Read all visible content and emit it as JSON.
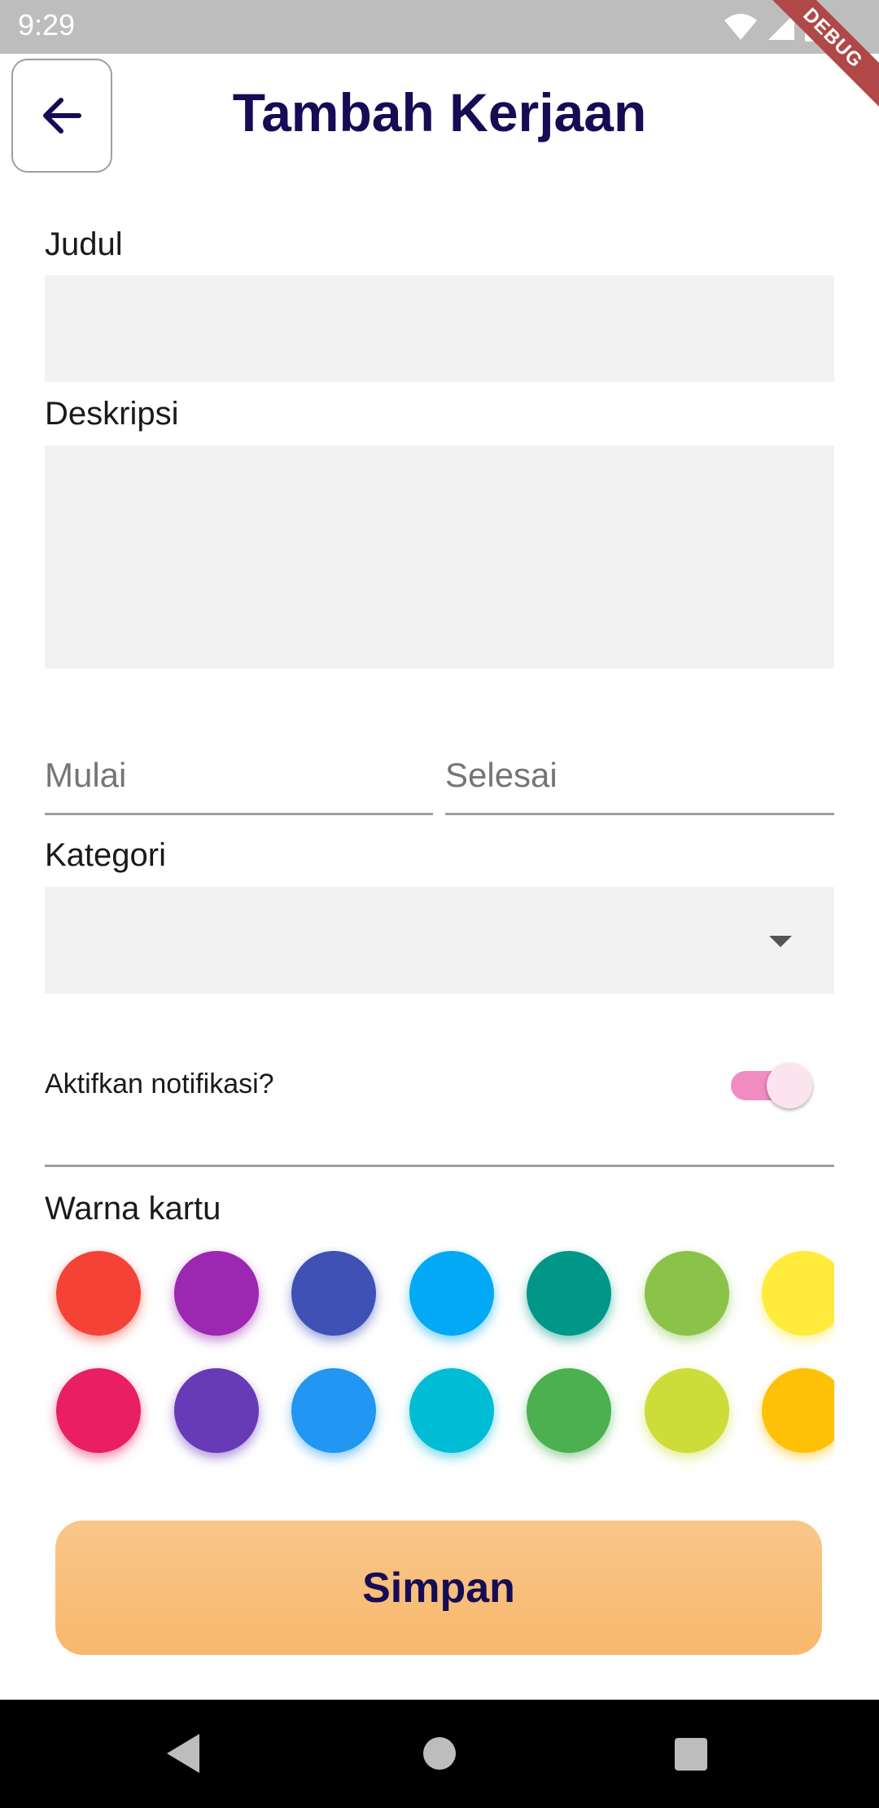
{
  "status_bar": {
    "time": "9:29",
    "debug_label": "DEBUG"
  },
  "header": {
    "title": "Tambah Kerjaan",
    "back_icon": "arrow-left-icon"
  },
  "form": {
    "judul_label": "Judul",
    "judul_value": "",
    "deskripsi_label": "Deskripsi",
    "deskripsi_value": "",
    "mulai_placeholder": "Mulai",
    "selesai_placeholder": "Selesai",
    "kategori_label": "Kategori",
    "kategori_value": "",
    "notification_label": "Aktifkan notifikasi?",
    "notification_enabled": true,
    "card_color_label": "Warna kartu"
  },
  "colors": {
    "row1": [
      "#f44336",
      "#9c27b0",
      "#3f51b5",
      "#03a9f4",
      "#009688",
      "#8bc34a",
      "#ffeb3b"
    ],
    "row2": [
      "#e91e63",
      "#673ab7",
      "#2196f3",
      "#00bcd4",
      "#4caf50",
      "#cddc39",
      "#ffc107"
    ],
    "title": "#150c55",
    "toggle_track": "#f08cbf",
    "button": "#f8b86c"
  },
  "actions": {
    "save_label": "Simpan"
  },
  "nav": {
    "back_icon": "nav-back-icon",
    "home_icon": "nav-home-icon",
    "recents_icon": "nav-recents-icon"
  }
}
